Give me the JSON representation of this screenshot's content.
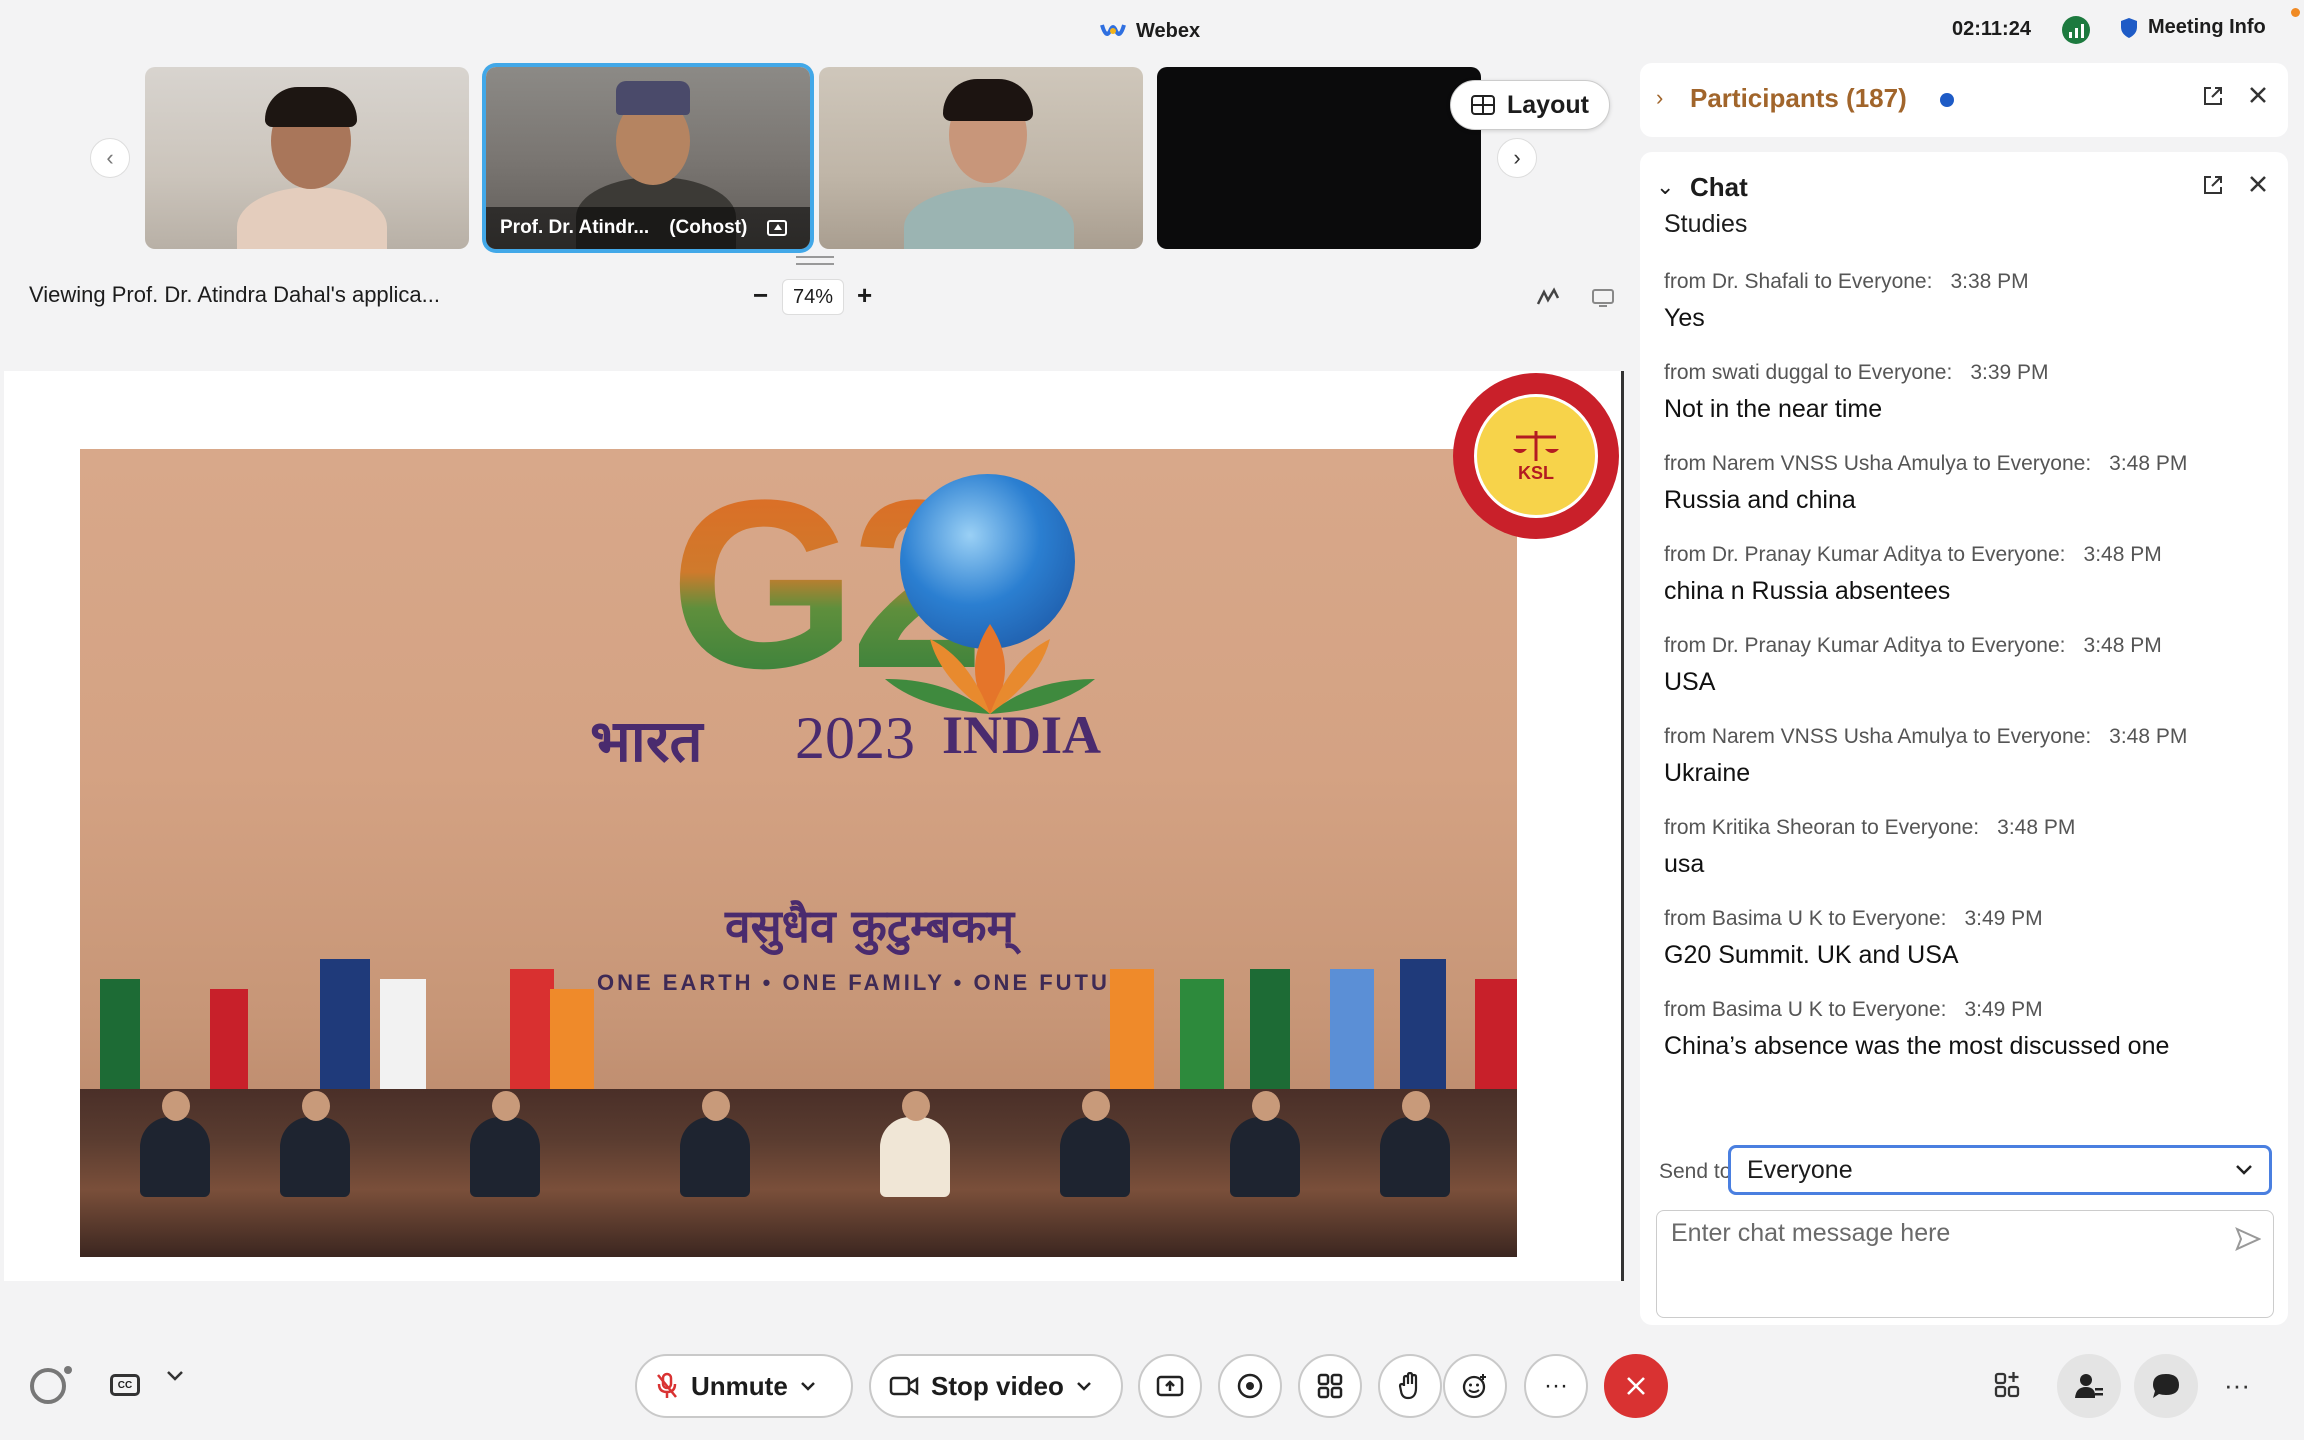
{
  "topbar": {
    "app_name": "Webex",
    "clock": "02:11:24",
    "meeting_info": "Meeting Info"
  },
  "thumbnails": {
    "active_label": "Prof. Dr. Atindr...",
    "active_role": "(Cohost)"
  },
  "layout_button": "Layout",
  "viewing_text": "Viewing Prof. Dr. Atindra Dahal's applica...",
  "zoom": {
    "minus": "−",
    "value": "74%",
    "plus": "+"
  },
  "slide": {
    "logo_text": "G2",
    "hindi_title": "भारत",
    "year": "2023",
    "country": "INDIA",
    "hindi_motto": "वसुधैव कुटुम्बकम्",
    "motto": "ONE EARTH • ONE FAMILY • ONE FUTURE",
    "school_logo_text": "KSL"
  },
  "participants": {
    "title": "Participants (187)"
  },
  "chat": {
    "title": "Chat",
    "partial_message": "Studies",
    "messages": [
      {
        "meta": "from Dr. Shafali to Everyone:",
        "time": "3:38  PM",
        "text": "Yes"
      },
      {
        "meta": "from swati duggal to Everyone:",
        "time": "3:39  PM",
        "text": "Not in the near time"
      },
      {
        "meta": "from Narem VNSS Usha Amulya to Everyone:",
        "time": "3:48  PM",
        "text": "Russia and china"
      },
      {
        "meta": "from Dr. Pranay Kumar Aditya to Everyone:",
        "time": "3:48  PM",
        "text": "china n Russia absentees"
      },
      {
        "meta": "from Dr. Pranay Kumar Aditya to Everyone:",
        "time": "3:48  PM",
        "text": "USA"
      },
      {
        "meta": "from Narem VNSS Usha Amulya to Everyone:",
        "time": "3:48  PM",
        "text": "Ukraine"
      },
      {
        "meta": "from Kritika Sheoran to Everyone:",
        "time": "3:48  PM",
        "text": "usa"
      },
      {
        "meta": "from Basima U K to Everyone:",
        "time": "3:49  PM",
        "text": "G20 Summit. UK and USA"
      },
      {
        "meta": "from Basima U K to Everyone:",
        "time": "3:49  PM",
        "text": "China’s absence was the most discussed one"
      }
    ],
    "send_to_label": "Send to:",
    "send_to_value": "Everyone",
    "input_placeholder": "Enter chat message here"
  },
  "toolbar": {
    "unmute": "Unmute",
    "stop_video": "Stop video",
    "more": "···",
    "more_right": "···",
    "cc": "CC"
  },
  "colors": {
    "accent_blue": "#42a8e8",
    "participants_title": "#a1652b",
    "end_call": "#d93232",
    "signal_green": "#1d7a3f"
  }
}
